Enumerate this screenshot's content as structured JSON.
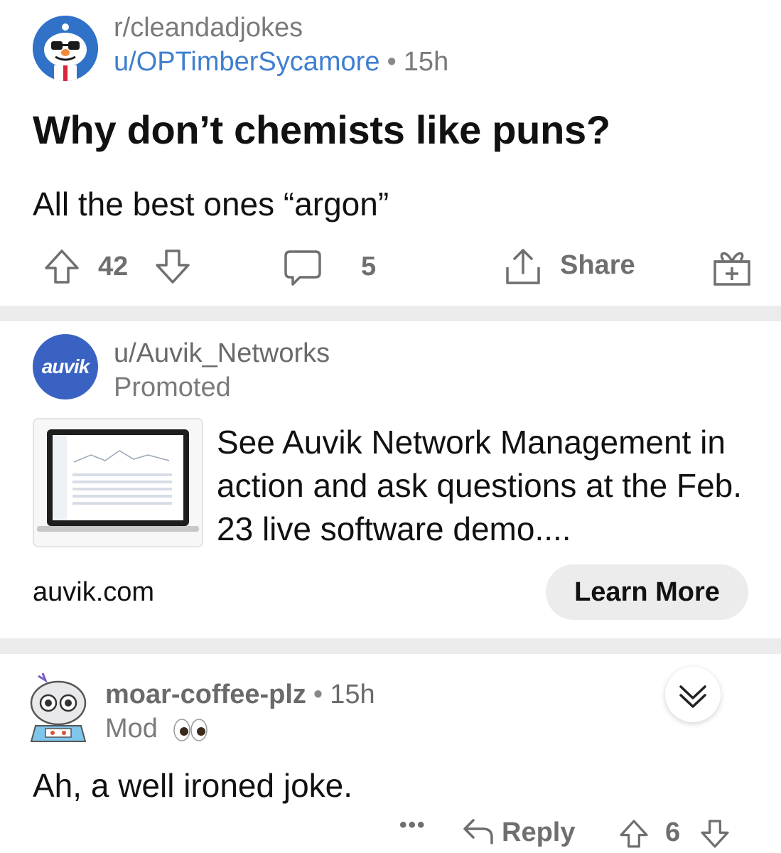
{
  "post": {
    "subreddit": "r/cleandadjokes",
    "author": "u/OPTimberSycamore",
    "separator": "•",
    "age": "15h",
    "title": "Why don’t chemists like puns?",
    "body": "All the best ones “argon”",
    "upvotes": "42",
    "comments": "5",
    "share_label": "Share"
  },
  "ad": {
    "logo_text": "auvik",
    "author": "u/Auvik_Networks",
    "promoted_label": "Promoted",
    "headline": "See Auvik Network Management in action and ask questions at the Feb. 23 live software demo....",
    "domain": "auvik.com",
    "cta_label": "Learn More"
  },
  "comment": {
    "author": "moar-coffee-plz",
    "separator": "•",
    "age": "15h",
    "flair": "Mod",
    "body": "Ah, a well ironed joke.",
    "more_label": "•••",
    "reply_label": "Reply",
    "score": "6"
  },
  "colors": {
    "link_blue": "#3f7fd0",
    "muted_gray": "#7a7a7a",
    "divider": "#ececec",
    "auvik_blue": "#3a62c2"
  },
  "icons": [
    "upvote-icon",
    "downvote-icon",
    "comment-icon",
    "share-icon",
    "award-icon",
    "chevron-down-icon",
    "reply-icon",
    "more-icon"
  ]
}
